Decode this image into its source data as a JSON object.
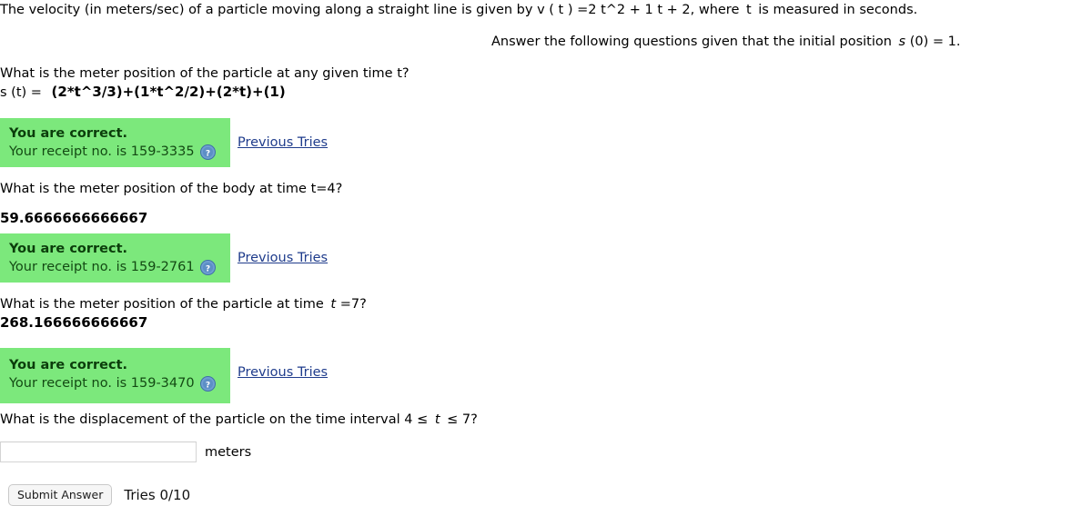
{
  "intro": {
    "line1_a": "The velocity (in meters/sec) of a particle moving along a straight line is given by v ( t ) =2 t^2 + 1 t + 2, where",
    "line1_var": "t",
    "line1_b": "is measured in seconds.",
    "line2_a": "Answer the following questions given that the initial position",
    "line2_var": "s",
    "line2_b": "(0) = 1."
  },
  "questions": [
    {
      "prompt": "What is the meter position of the particle at any given time t?",
      "answer_label": "s (t) =",
      "answer_value": "(2*t^3/3)+(1*t^2/2)+(2*t)+(1)",
      "feedback_title": "You are correct.",
      "feedback_receipt": "Your receipt no. is 159-3335",
      "help_icon": "question-mark-help-icon",
      "previous_tries": "Previous Tries"
    },
    {
      "prompt_a": "What is the meter position of the body at time t=4?",
      "answer_value": "59.6666666666667",
      "feedback_title": "You are correct.",
      "feedback_receipt": "Your receipt no. is 159-2761",
      "help_icon": "question-mark-help-icon",
      "previous_tries": "Previous Tries"
    },
    {
      "prompt_a": "What is the meter position of the particle at time",
      "prompt_var": "t",
      "prompt_b": "=7?",
      "answer_value": "268.166666666667",
      "feedback_title": "You are correct.",
      "feedback_receipt": "Your receipt no. is 159-3470",
      "help_icon": "question-mark-help-icon",
      "previous_tries": "Previous Tries"
    }
  ],
  "final_question": {
    "prompt_a": "What is the displacement of the particle on the time interval 4 ≤",
    "prompt_var": "t",
    "prompt_b": "≤ 7?",
    "input_value": "",
    "input_placeholder": "",
    "units": "meters"
  },
  "submit": {
    "button_label": "Submit Answer",
    "tries_text": "Tries 0/10"
  },
  "colors": {
    "feedback_background": "#7CE87C",
    "feedback_title_text": "#0b3d0b",
    "link": "#1f3c8c",
    "help_icon_fill": "#5b8fc9"
  }
}
